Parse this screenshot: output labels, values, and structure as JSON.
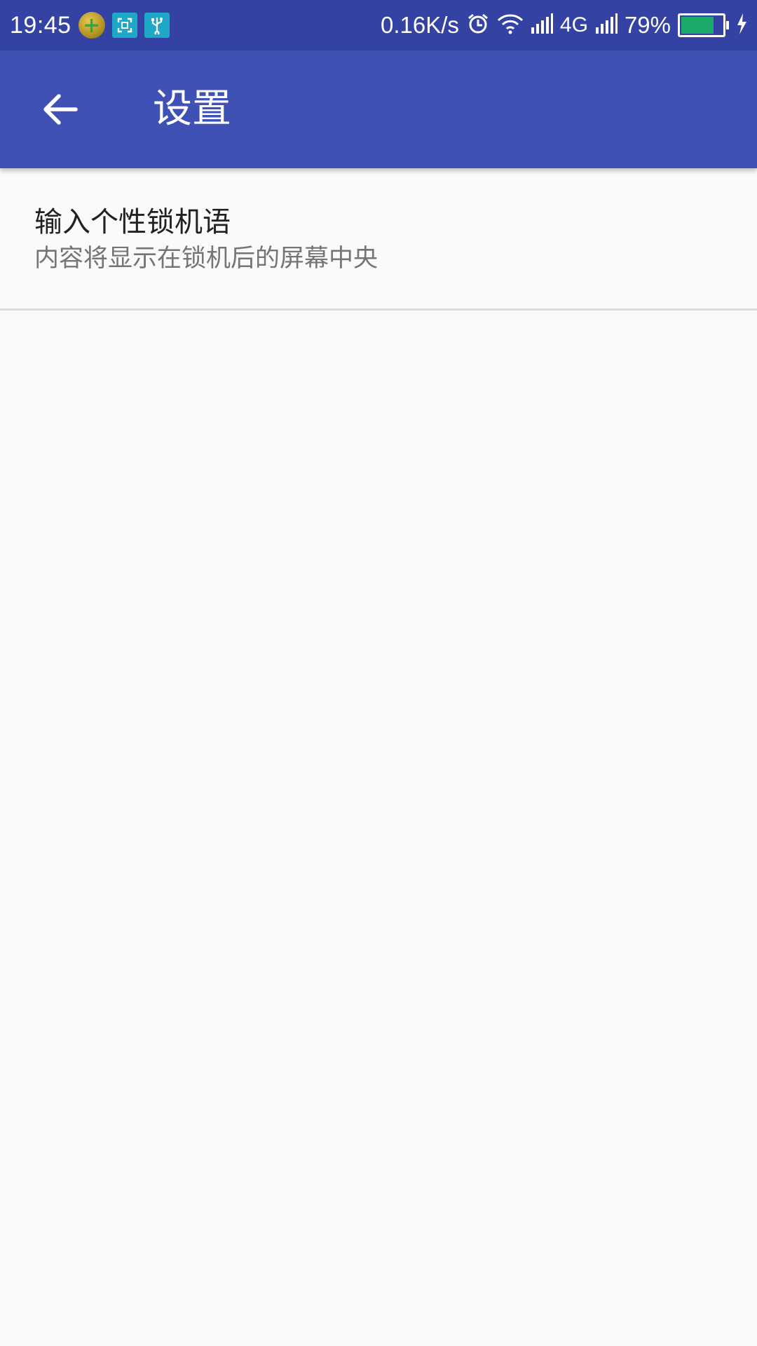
{
  "status_bar": {
    "time": "19:45",
    "net_speed": "0.16K/s",
    "network_type": "4G",
    "battery_percent_text": "79%",
    "battery_level": 0.79,
    "icons": [
      "game-app-icon",
      "screenshot-icon",
      "usb-icon",
      "alarm-icon",
      "wifi-icon",
      "signal-icon",
      "signal-icon-2",
      "battery-icon",
      "charging-icon"
    ]
  },
  "app_bar": {
    "title": "设置",
    "back_icon": "arrow-back-icon",
    "color": "#3f51b5"
  },
  "settings": {
    "items": [
      {
        "title": "输入个性锁机语",
        "summary": "内容将显示在锁机后的屏幕中央"
      }
    ]
  }
}
